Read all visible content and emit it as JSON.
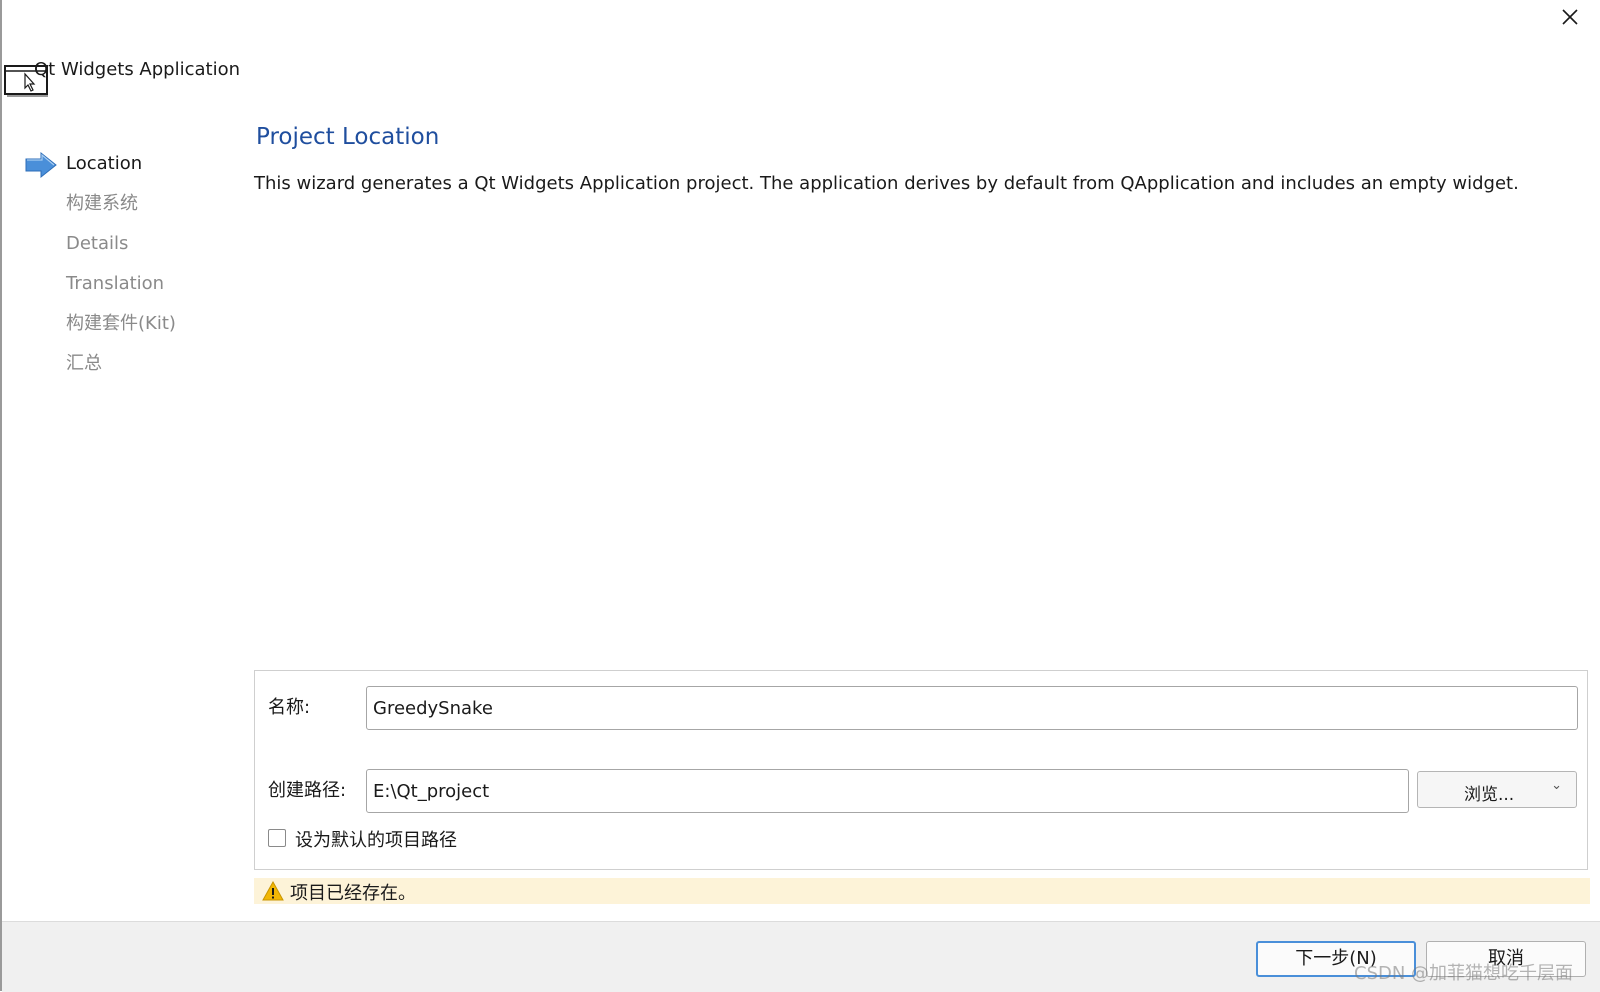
{
  "window": {
    "title": "Qt Widgets Application",
    "close_icon": "close-icon"
  },
  "steps": [
    {
      "label": "Location",
      "current": true
    },
    {
      "label": "构建系统",
      "current": false
    },
    {
      "label": "Details",
      "current": false
    },
    {
      "label": "Translation",
      "current": false
    },
    {
      "label": "构建套件(Kit)",
      "current": false
    },
    {
      "label": "汇总",
      "current": false
    }
  ],
  "page": {
    "title": "Project Location",
    "description": "This wizard generates a Qt Widgets Application project. The application derives by default from QApplication and includes an empty widget."
  },
  "form": {
    "name_label": "名称:",
    "name_value": "GreedySnake",
    "path_label": "创建路径:",
    "path_value": "E:\\Qt_project",
    "browse_label": "浏览...",
    "default_path_label": "设为默认的项目路径",
    "default_path_checked": false
  },
  "warning": {
    "text": "项目已经存在。",
    "color": "#fdf3d8"
  },
  "footer": {
    "next_label": "下一步(N)",
    "cancel_label": "取消"
  },
  "watermark": "CSDN @加菲猫想吃千层面",
  "colors": {
    "title_blue": "#1f4e9e",
    "step_arrow": "#4a8fd9",
    "warning_icon": "#f2b705"
  }
}
